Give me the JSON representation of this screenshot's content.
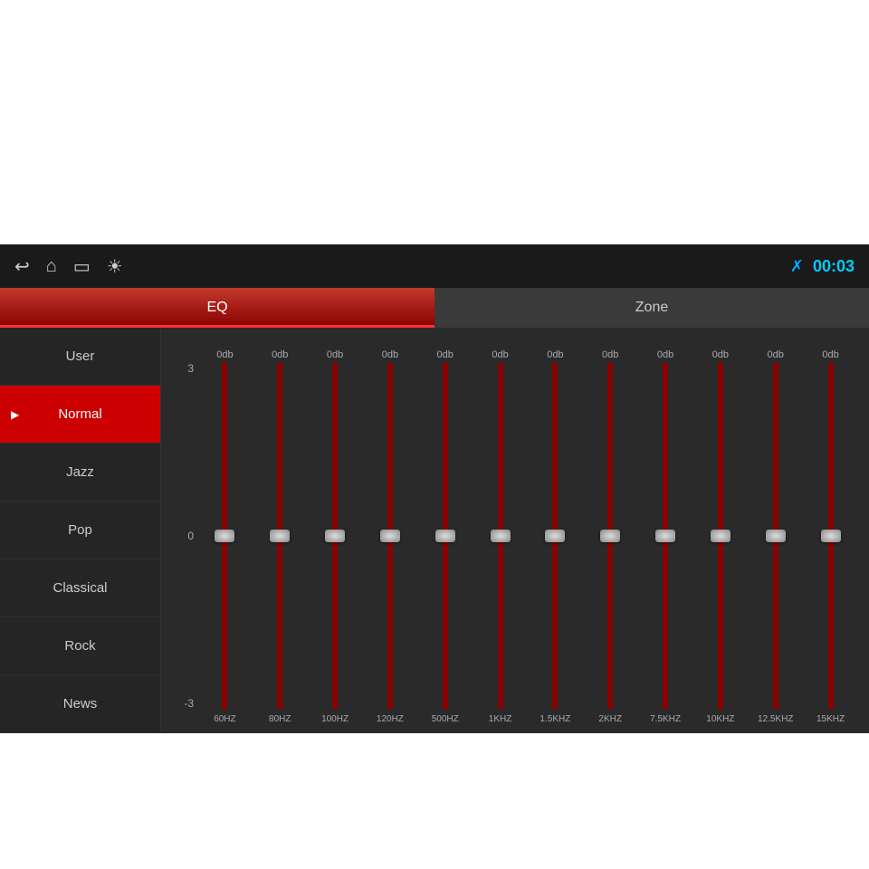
{
  "topbar": {
    "time": "00:03",
    "bt_icon": "bluetooth"
  },
  "tabs": [
    {
      "id": "eq",
      "label": "EQ",
      "active": true
    },
    {
      "id": "zone",
      "label": "Zone",
      "active": false
    }
  ],
  "sidebar": {
    "items": [
      {
        "id": "user",
        "label": "User",
        "active": false
      },
      {
        "id": "normal",
        "label": "Normal",
        "active": true
      },
      {
        "id": "jazz",
        "label": "Jazz",
        "active": false
      },
      {
        "id": "pop",
        "label": "Pop",
        "active": false
      },
      {
        "id": "classical",
        "label": "Classical",
        "active": false
      },
      {
        "id": "rock",
        "label": "Rock",
        "active": false
      },
      {
        "id": "news",
        "label": "News",
        "active": false
      }
    ]
  },
  "eq": {
    "scale": {
      "top": "3",
      "mid": "0",
      "bot": "-3"
    },
    "bands": [
      {
        "freq": "60HZ",
        "db": "0db",
        "value": 0
      },
      {
        "freq": "80HZ",
        "db": "0db",
        "value": 0
      },
      {
        "freq": "100HZ",
        "db": "0db",
        "value": 0
      },
      {
        "freq": "120HZ",
        "db": "0db",
        "value": 0
      },
      {
        "freq": "500HZ",
        "db": "0db",
        "value": 0
      },
      {
        "freq": "1KHZ",
        "db": "0db",
        "value": 0
      },
      {
        "freq": "1.5KHZ",
        "db": "0db",
        "value": 0
      },
      {
        "freq": "2KHZ",
        "db": "0db",
        "value": 0
      },
      {
        "freq": "7.5KHZ",
        "db": "0db",
        "value": 0
      },
      {
        "freq": "10KHZ",
        "db": "0db",
        "value": 0
      },
      {
        "freq": "12.5KHZ",
        "db": "0db",
        "value": 0
      },
      {
        "freq": "15KHZ",
        "db": "0db",
        "value": 0
      }
    ]
  }
}
